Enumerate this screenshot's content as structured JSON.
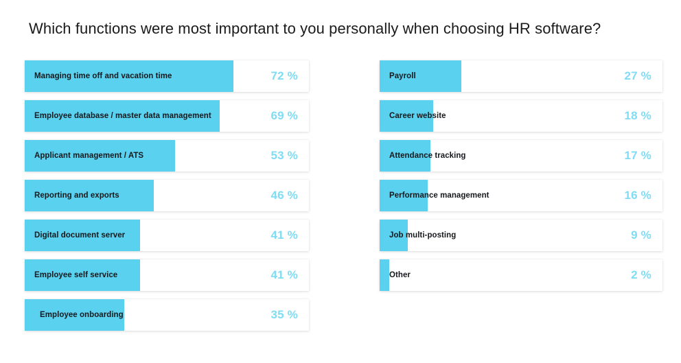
{
  "chart_data": {
    "type": "bar",
    "title": "Which functions were most important to you personally when choosing HR software?",
    "xlabel": "",
    "ylabel": "",
    "orientation": "horizontal",
    "value_unit": "%",
    "value_suffix": " %",
    "xlim": [
      0,
      100
    ],
    "grid": false,
    "legend": null,
    "bar_color": "#5ad1ee",
    "value_label_color": "#7fdcf4",
    "track_color": "#ffffff",
    "background": "#ffffff",
    "title_color": "#1a1a1a",
    "label_color": "#16181c",
    "categories": [
      "Managing time off and vacation time",
      "Employee database / master data management",
      "Applicant management / ATS",
      "Reporting and exports",
      "Digital document server",
      "Employee self service",
      "Employee onboarding",
      "Payroll",
      "Career website",
      "Attendance tracking",
      "Performance management",
      "Job multi-posting",
      "Other"
    ],
    "values": [
      72,
      69,
      53,
      46,
      41,
      41,
      35,
      27,
      18,
      17,
      16,
      9,
      2
    ],
    "columns": {
      "left": {
        "items": [
          {
            "label": "Managing time off and vacation time",
            "value": 72,
            "value_text": "72 %",
            "bar_pct": 73.5,
            "indented": false
          },
          {
            "label": "Employee database / master data management",
            "value": 69,
            "value_text": "69 %",
            "bar_pct": 68.5,
            "indented": false
          },
          {
            "label": "Applicant management / ATS",
            "value": 53,
            "value_text": "53 %",
            "bar_pct": 53.0,
            "indented": false
          },
          {
            "label": "Reporting and exports",
            "value": 46,
            "value_text": "46 %",
            "bar_pct": 45.5,
            "indented": false
          },
          {
            "label": "Digital document server",
            "value": 41,
            "value_text": "41 %",
            "bar_pct": 40.5,
            "indented": false
          },
          {
            "label": "Employee self service",
            "value": 41,
            "value_text": "41 %",
            "bar_pct": 40.5,
            "indented": false
          },
          {
            "label": "Employee onboarding",
            "value": 35,
            "value_text": "35 %",
            "bar_pct": 35.0,
            "indented": true
          }
        ]
      },
      "right": {
        "items": [
          {
            "label": "Payroll",
            "value": 27,
            "value_text": "27 %",
            "bar_pct": 29.0,
            "indented": false
          },
          {
            "label": "Career website",
            "value": 18,
            "value_text": "18 %",
            "bar_pct": 19.0,
            "indented": false
          },
          {
            "label": "Attendance tracking",
            "value": 17,
            "value_text": "17 %",
            "bar_pct": 18.0,
            "indented": false
          },
          {
            "label": "Performance management",
            "value": 16,
            "value_text": "16 %",
            "bar_pct": 17.0,
            "indented": false
          },
          {
            "label": "Job multi-posting",
            "value": 9,
            "value_text": "9 %",
            "bar_pct": 10.0,
            "indented": false
          },
          {
            "label": "Other",
            "value": 2,
            "value_text": "2 %",
            "bar_pct": 3.4,
            "indented": false
          }
        ]
      }
    }
  }
}
